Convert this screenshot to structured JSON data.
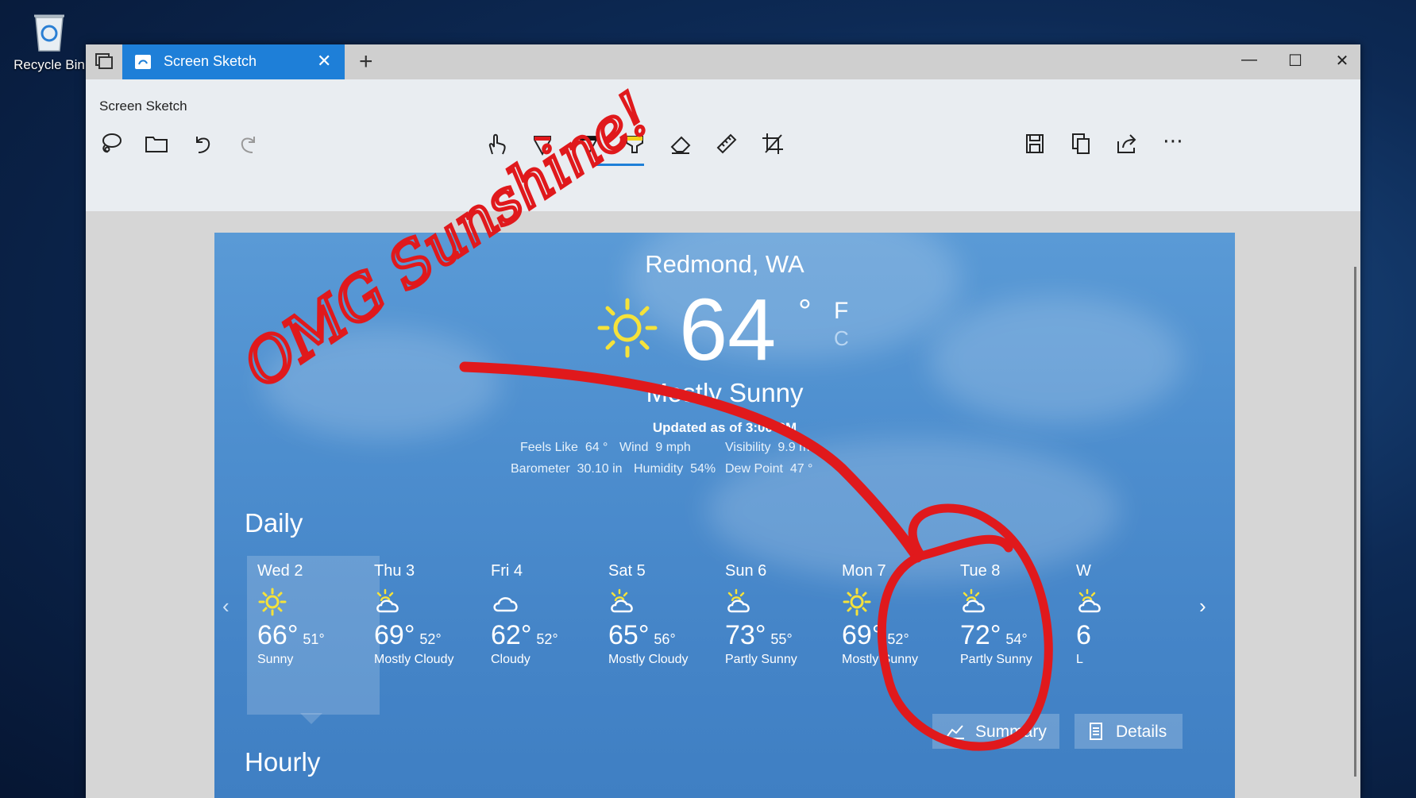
{
  "desktop": {
    "recycle_bin_label": "Recycle Bin"
  },
  "window": {
    "tab_title": "Screen Sketch",
    "app_title": "Screen Sketch",
    "close_tab_glyph": "✕",
    "new_tab_glyph": "+",
    "minimize_glyph": "—",
    "maximize_glyph": "☐",
    "close_glyph": "✕",
    "more_glyph": "⋯"
  },
  "toolbar": {
    "left_icons": [
      "lasso-icon",
      "open-folder-icon",
      "undo-icon",
      "redo-icon"
    ],
    "center_icons": [
      "touch-writing-icon",
      "ballpoint-pen-icon",
      "pencil-icon",
      "highlighter-icon",
      "eraser-icon",
      "ruler-icon",
      "crop-icon"
    ],
    "right_icons": [
      "save-icon",
      "copy-icon",
      "share-icon",
      "more-icon"
    ],
    "active_tool": "ballpoint-pen-icon",
    "accent_color": "#1e7fd8"
  },
  "weather": {
    "city": "Redmond, WA",
    "temperature": "64",
    "degree": "°",
    "unit_f": "F",
    "unit_c": "C",
    "condition": "Mostly Sunny",
    "updated": "Updated as of 3:00 PM",
    "details_row1": [
      {
        "label": "Feels Like",
        "value": "64 °"
      },
      {
        "label": "Wind",
        "value": "9 mph"
      },
      {
        "label": "Visibility",
        "value": "9.9 mi"
      }
    ],
    "details_row2": [
      {
        "label": "Barometer",
        "value": "30.10 in"
      },
      {
        "label": "Humidity",
        "value": "54%"
      },
      {
        "label": "Dew Point",
        "value": "47 °"
      }
    ],
    "daily_label": "Daily",
    "hourly_label": "Hourly",
    "days": [
      {
        "name": "Wed 2",
        "icon": "sun-icon",
        "hi": "66°",
        "lo": "51°",
        "desc": "Sunny"
      },
      {
        "name": "Thu 3",
        "icon": "partly-cloudy-icon",
        "hi": "69°",
        "lo": "52°",
        "desc": "Mostly Cloudy"
      },
      {
        "name": "Fri 4",
        "icon": "cloud-icon",
        "hi": "62°",
        "lo": "52°",
        "desc": "Cloudy"
      },
      {
        "name": "Sat 5",
        "icon": "partly-cloudy-icon",
        "hi": "65°",
        "lo": "56°",
        "desc": "Mostly Cloudy"
      },
      {
        "name": "Sun 6",
        "icon": "partly-cloudy-icon",
        "hi": "73°",
        "lo": "55°",
        "desc": "Partly Sunny"
      },
      {
        "name": "Mon 7",
        "icon": "sun-icon",
        "hi": "69°",
        "lo": "52°",
        "desc": "Mostly Sunny"
      },
      {
        "name": "Tue 8",
        "icon": "partly-cloudy-icon",
        "hi": "72°",
        "lo": "54°",
        "desc": "Partly Sunny"
      },
      {
        "name": "W",
        "icon": "partly-cloudy-icon",
        "hi": "6",
        "lo": "",
        "desc": "L"
      }
    ],
    "summary_button": "Summary",
    "details_button": "Details",
    "prev_glyph": "‹",
    "next_glyph": "›"
  },
  "annotation": {
    "handwritten_text": "OMG Sunshine!",
    "ink_color": "#e0191c"
  }
}
